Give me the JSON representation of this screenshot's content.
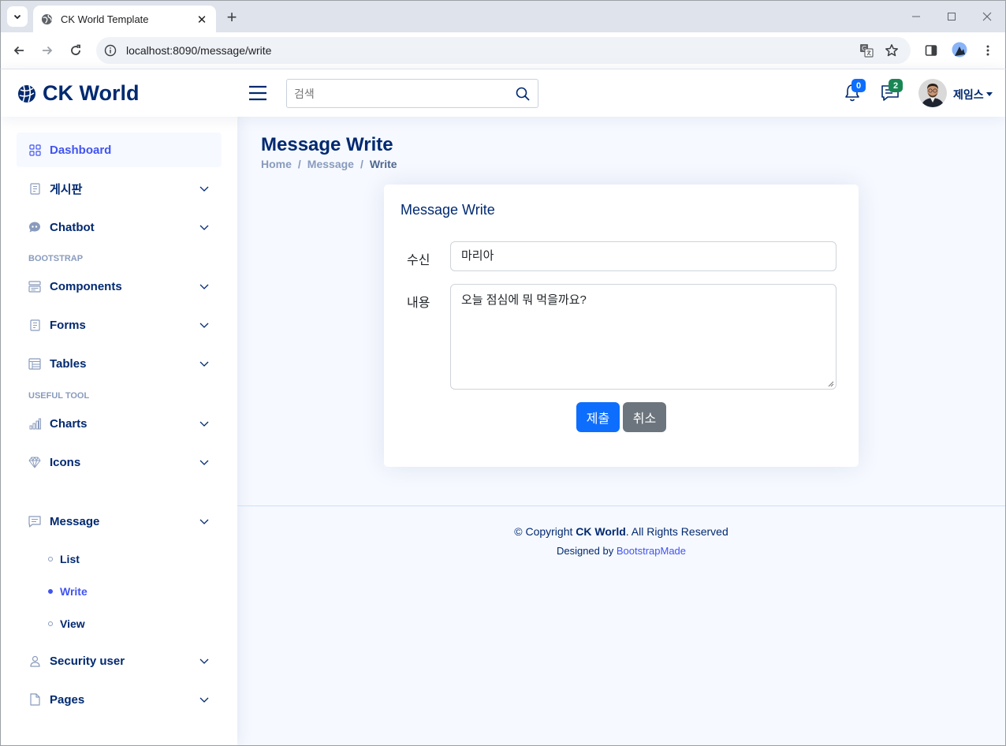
{
  "browser": {
    "tab_title": "CK World Template",
    "url": "localhost:8090/message/write"
  },
  "header": {
    "logo_text": "CK World",
    "search_placeholder": "검색",
    "notification_count": "0",
    "message_count": "2",
    "profile_name": "제임스",
    "notification_badge_color": "#0d6efd",
    "message_badge_color": "#198754"
  },
  "sidebar": {
    "items": [
      {
        "label": "Dashboard"
      },
      {
        "label": "게시판"
      },
      {
        "label": "Chatbot"
      },
      {
        "label": "Components"
      },
      {
        "label": "Forms"
      },
      {
        "label": "Tables"
      },
      {
        "label": "Charts"
      },
      {
        "label": "Icons"
      },
      {
        "label": "Message"
      },
      {
        "label": "Security user"
      },
      {
        "label": "Pages"
      }
    ],
    "headings": [
      "BOOTSTRAP",
      "USEFUL TOOL"
    ],
    "message_subitems": [
      {
        "label": "List"
      },
      {
        "label": "Write"
      },
      {
        "label": "View"
      }
    ]
  },
  "main": {
    "page_title": "Message Write",
    "breadcrumb": [
      "Home",
      "Message",
      "Write"
    ],
    "breadcrumb_separator": "/",
    "card_title": "Message Write",
    "recipient_label": "수신",
    "recipient_value": "마리아",
    "content_label": "내용",
    "content_value": "오늘 점심에 뭐 먹을까요?",
    "submit_label": "제출",
    "cancel_label": "취소"
  },
  "footer": {
    "copyright_prefix": "© Copyright",
    "copyright_brand": "CK World",
    "copyright_suffix": ". All Rights Reserved",
    "designed_by": "Designed by",
    "designer_link": "BootstrapMade"
  },
  "colors": {
    "accent": "#4154f1",
    "navy": "#012970",
    "primary_button": "#0d6efd",
    "secondary_button": "#6c757d"
  }
}
